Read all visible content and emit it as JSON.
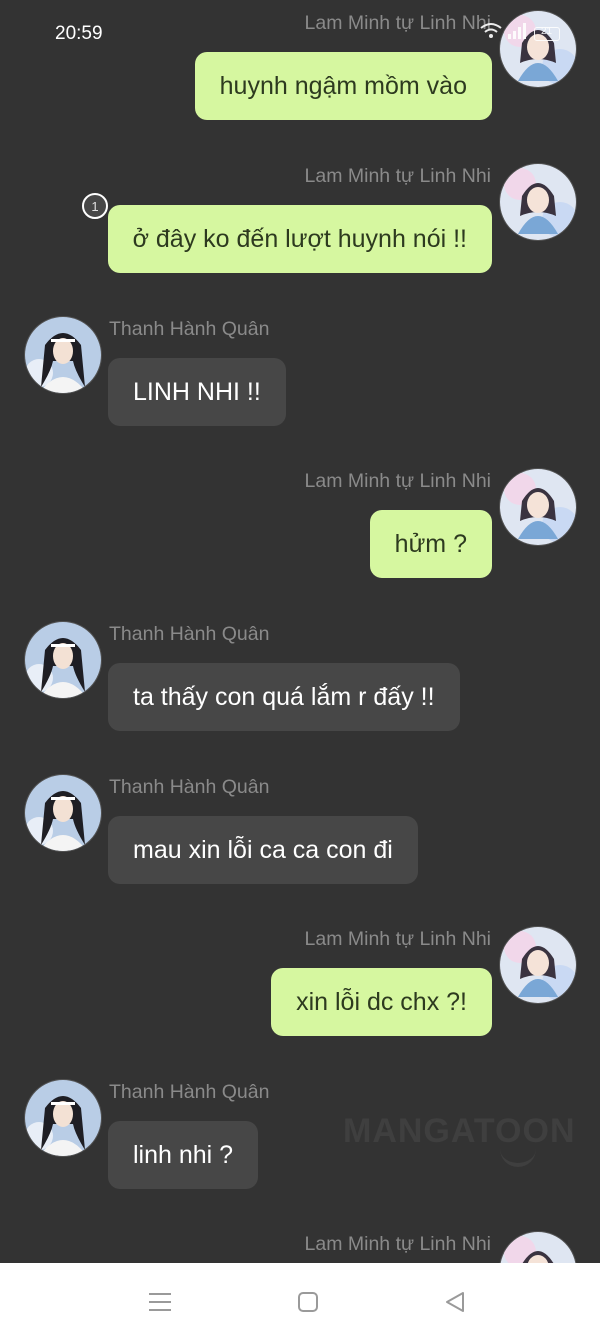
{
  "status_bar": {
    "time": "20:59",
    "battery": "21"
  },
  "chat": {
    "messages": [
      {
        "side": "right",
        "sender": "Lam Minh tự Linh Nhi",
        "text": "huynh ngậm mồm vào"
      },
      {
        "side": "right",
        "sender": "Lam Minh tự Linh Nhi",
        "text": "ở đây ko đến lượt huynh nói !!",
        "badge": "1"
      },
      {
        "side": "left",
        "sender": "Thanh Hành Quân",
        "text": "LINH NHI !!"
      },
      {
        "side": "right",
        "sender": "Lam Minh tự Linh Nhi",
        "text": "hửm ?"
      },
      {
        "side": "left",
        "sender": "Thanh Hành Quân",
        "text": "ta thấy con quá lắm r đấy !!"
      },
      {
        "side": "left",
        "sender": "Thanh Hành Quân",
        "text": "mau xin lỗi ca ca con đi"
      },
      {
        "side": "right",
        "sender": "Lam Minh tự Linh Nhi",
        "text": "xin lỗi dc chx ?!"
      },
      {
        "side": "left",
        "sender": "Thanh Hành Quân",
        "text": "linh nhi ?"
      },
      {
        "side": "right",
        "sender": "Lam Minh tự Linh Nhi",
        "text": ""
      }
    ]
  },
  "watermark": "MANGATOON",
  "icons": {
    "wifi": "wifi-icon",
    "signal": "signal-icon",
    "battery": "battery-icon",
    "menu": "menu-icon",
    "home": "home-icon",
    "back": "back-icon"
  },
  "colors": {
    "background": "#333333",
    "right_bubble": "#d6f7a0",
    "left_bubble": "#474747",
    "name_text": "#8a8a8a"
  }
}
